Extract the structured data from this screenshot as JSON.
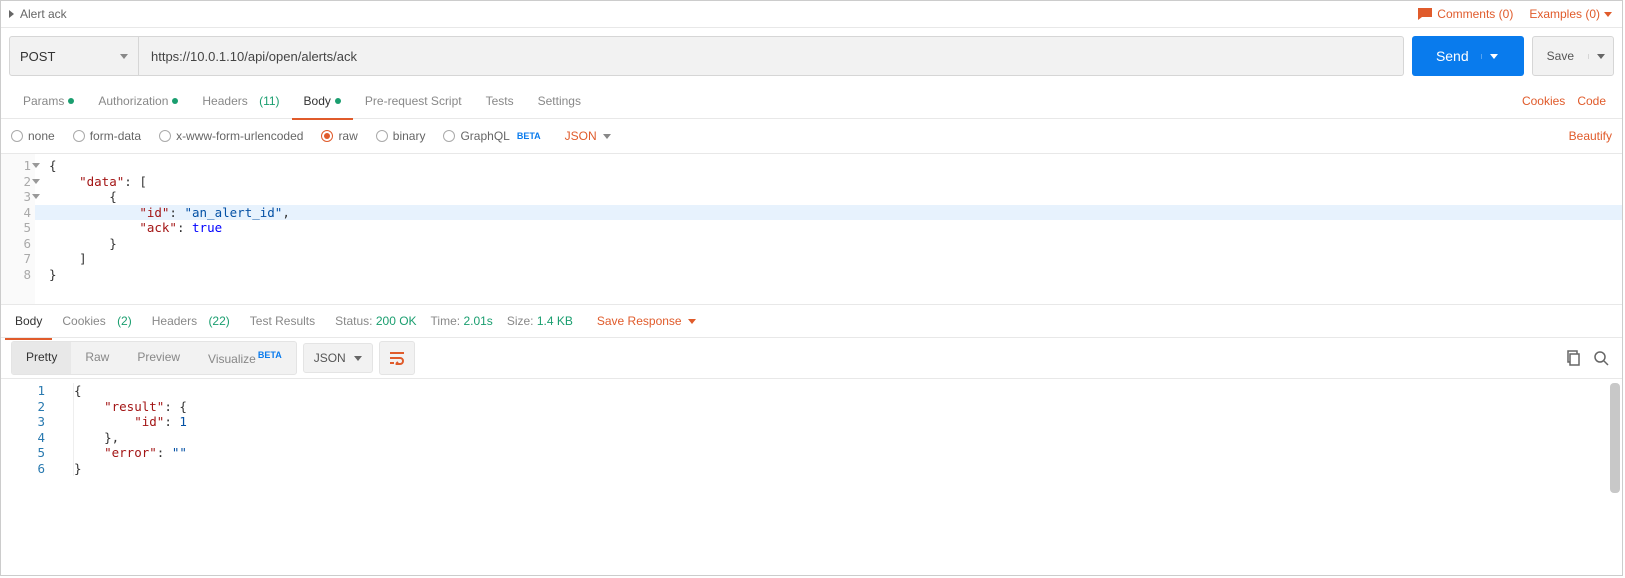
{
  "title": "Alert ack",
  "top": {
    "comments": "Comments (0)",
    "examples": "Examples (0)"
  },
  "request": {
    "method": "POST",
    "url": "https://10.0.1.10/api/open/alerts/ack",
    "send": "Send",
    "save": "Save"
  },
  "tabs": {
    "params": "Params",
    "auth": "Authorization",
    "headers": "Headers",
    "headers_count": "(11)",
    "body": "Body",
    "pre": "Pre-request Script",
    "tests": "Tests",
    "settings": "Settings",
    "cookies": "Cookies",
    "code": "Code"
  },
  "bodytype": {
    "none": "none",
    "form": "form-data",
    "xwww": "x-www-form-urlencoded",
    "raw": "raw",
    "binary": "binary",
    "graphql": "GraphQL",
    "beta": "BETA",
    "lang": "JSON",
    "beautify": "Beautify"
  },
  "reqbody": {
    "l1": "{",
    "l2_k": "\"data\"",
    "l2_r": ": [",
    "l3": "{",
    "l4_k": "\"id\"",
    "l4_v": "\"an_alert_id\"",
    "l5_k": "\"ack\"",
    "l5_v": "true",
    "l6": "}",
    "l7": "]",
    "l8": "}"
  },
  "resp_tabs": {
    "body": "Body",
    "cookies": "Cookies",
    "cookies_n": "(2)",
    "headers": "Headers",
    "headers_n": "(22)",
    "tests": "Test Results"
  },
  "status": {
    "status_l": "Status:",
    "status_v": "200 OK",
    "time_l": "Time:",
    "time_v": "2.01s",
    "size_l": "Size:",
    "size_v": "1.4 KB",
    "save": "Save Response"
  },
  "view": {
    "pretty": "Pretty",
    "raw": "Raw",
    "preview": "Preview",
    "visualize": "Visualize",
    "beta": "BETA",
    "lang": "JSON"
  },
  "respbody": {
    "l1": "{",
    "l2_k": "\"result\"",
    "l2_r": ": {",
    "l3_k": "\"id\"",
    "l3_v": "1",
    "l4": "},",
    "l5_k": "\"error\"",
    "l5_v": "\"\"",
    "l6": "}"
  }
}
